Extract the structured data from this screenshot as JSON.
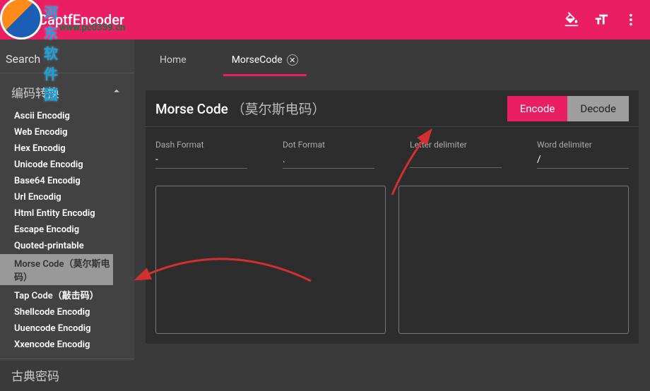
{
  "header": {
    "title": "CaptfEncoder"
  },
  "search": {
    "label": "Search"
  },
  "sidebar": {
    "category1": "编码转换",
    "category2": "古典密码",
    "items": [
      "Ascii Encodig",
      "Web Encodig",
      "Hex Encodig",
      "Unicode Encodig",
      "Base64 Encodig",
      "Url Encodig",
      "Html Entity Encodig",
      "Escape Encodig",
      "Quoted-printable",
      "Morse Code（莫尔斯电码）",
      "Tap Code（敲击码）",
      "Shellcode Encodig",
      "Uuencode Encodig",
      "Xxencode Encodig"
    ],
    "selectedIndex": 9
  },
  "tabs": {
    "home": "Home",
    "active": "MorseCode"
  },
  "panel": {
    "title_en": "Morse Code",
    "title_cn": "（莫尔斯电码）",
    "encode": "Encode",
    "decode": "Decode"
  },
  "params": {
    "dash_label": "Dash Format",
    "dash_value": "-",
    "dot_label": "Dot Format",
    "dot_value": ".",
    "letter_label": "Letter delimiter",
    "letter_value": "",
    "word_label": "Word delimiter",
    "word_value": "/"
  },
  "watermark": {
    "text": "河东软件园",
    "url": "www.pc0359.cn"
  }
}
